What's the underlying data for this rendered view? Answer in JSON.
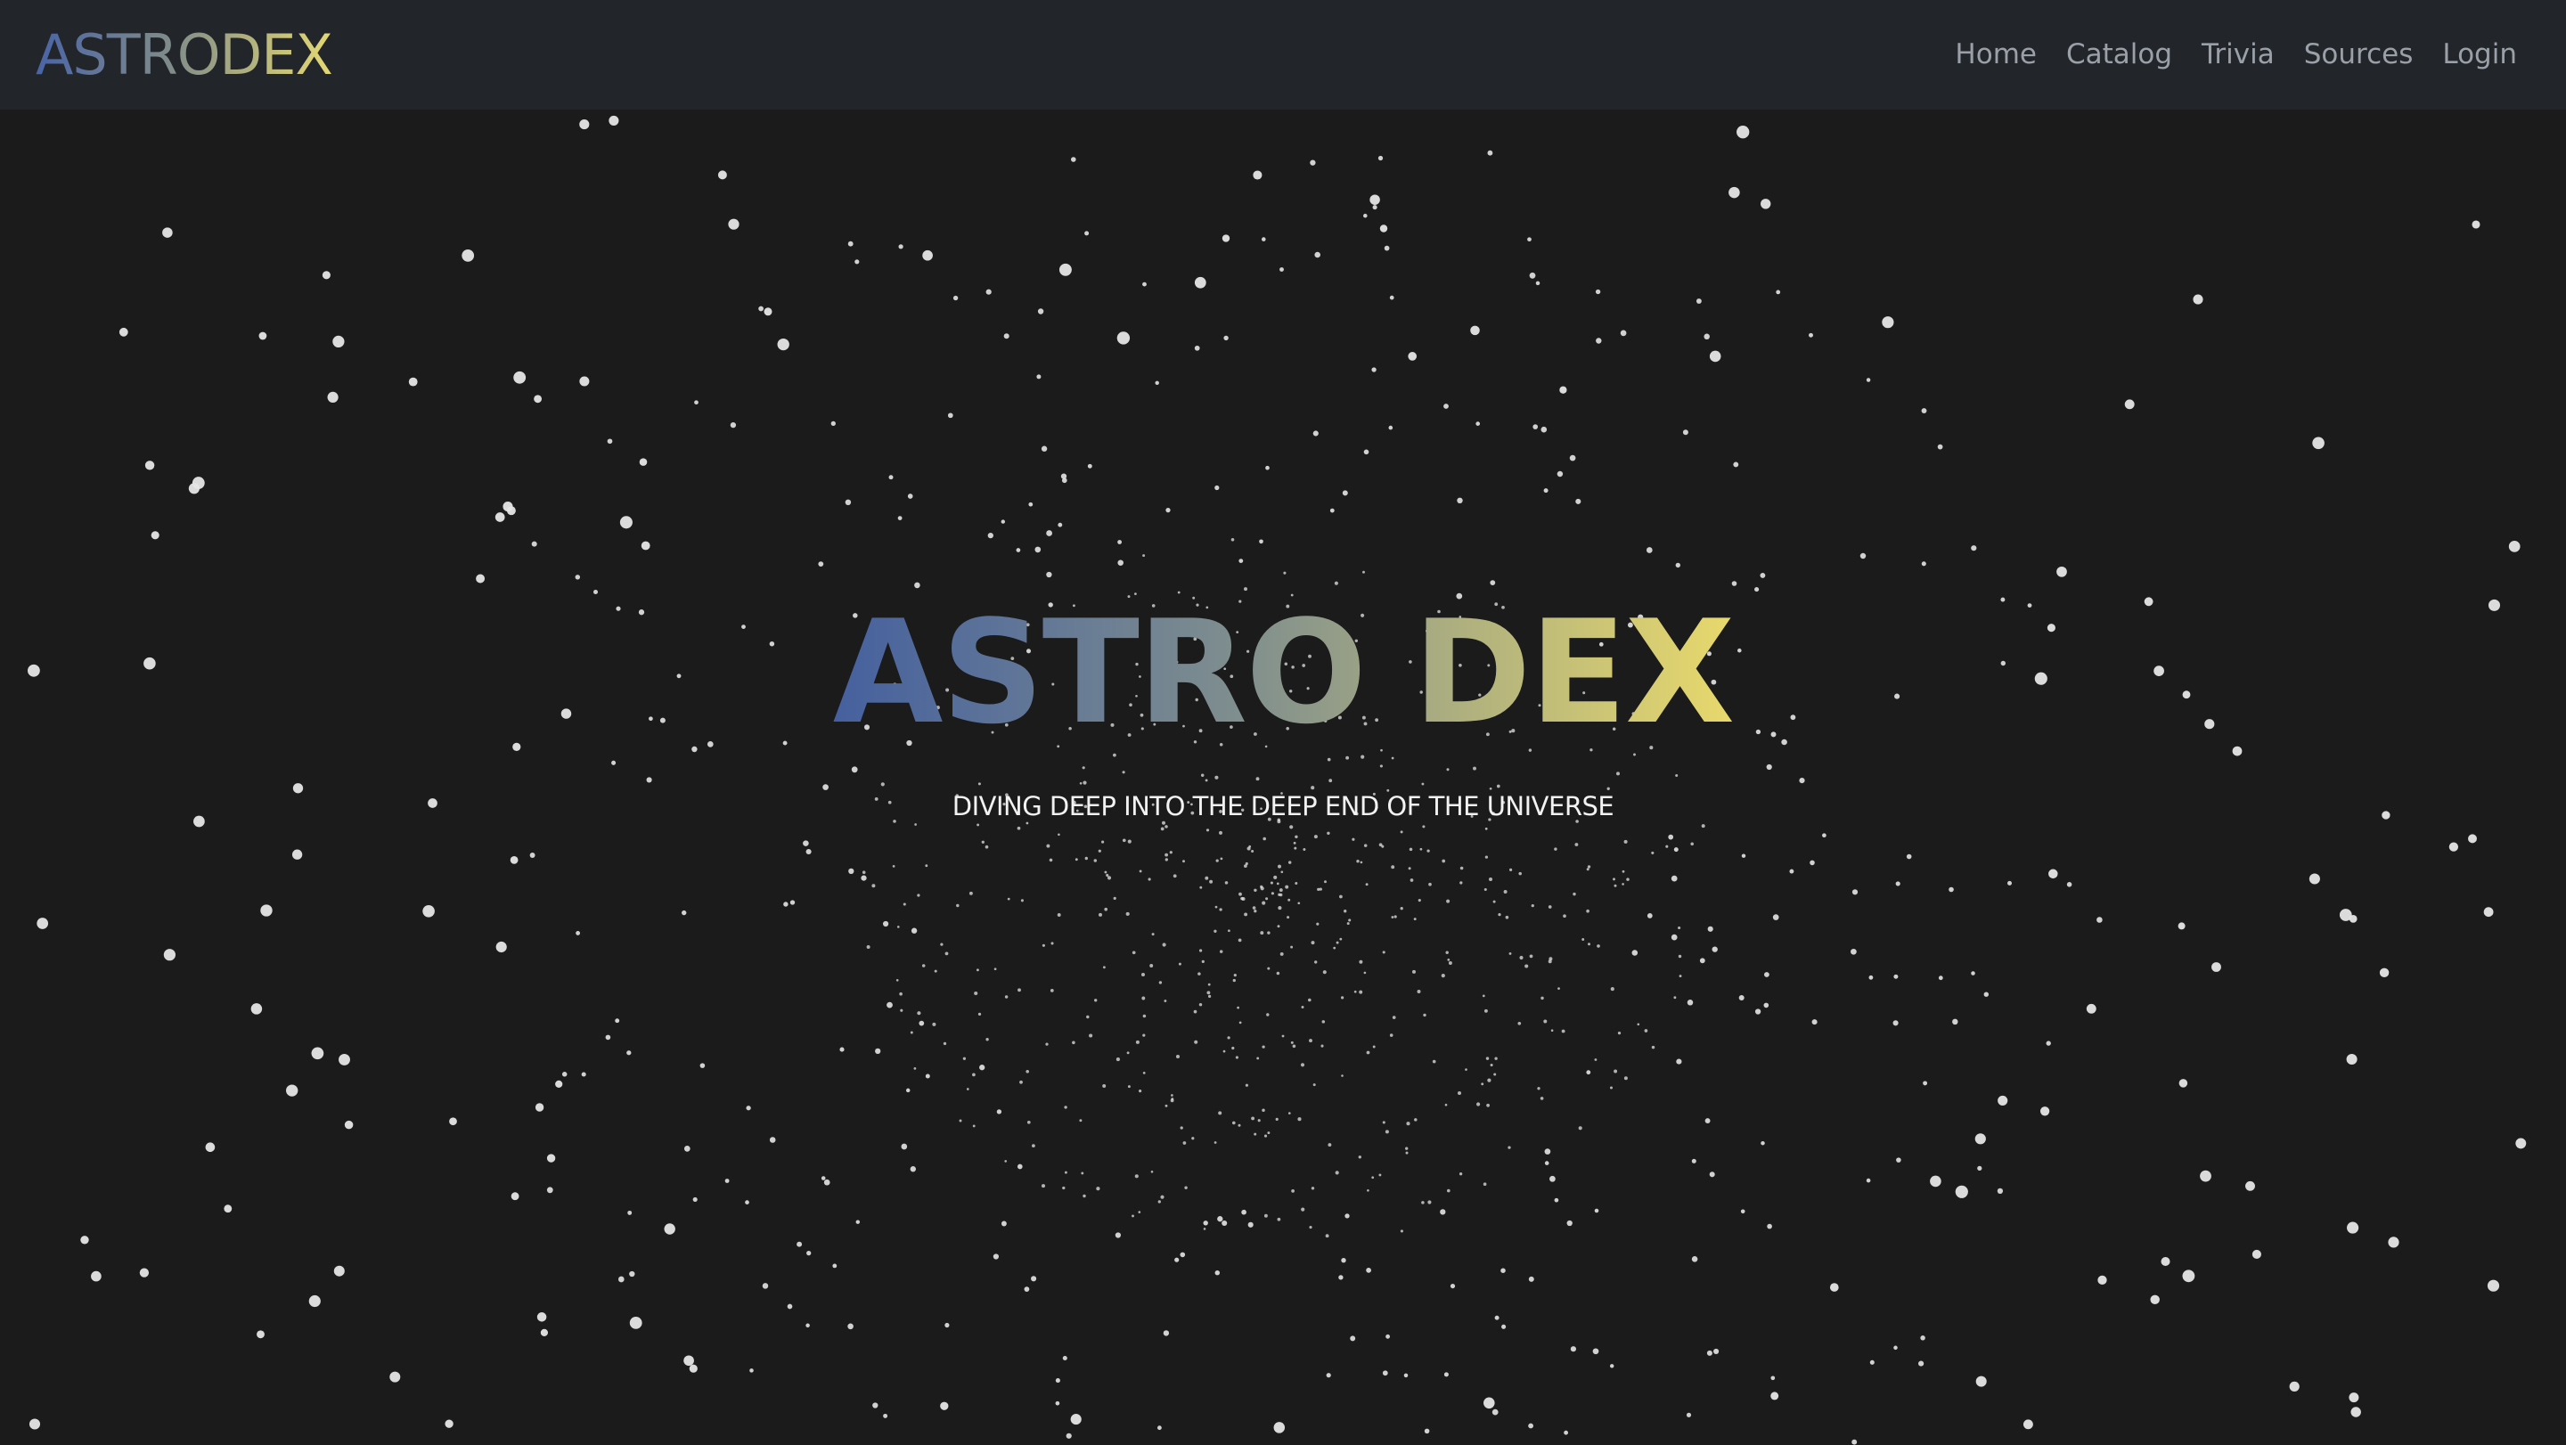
{
  "navbar": {
    "brand": "ASTRODEX",
    "links": [
      {
        "label": "Home"
      },
      {
        "label": "Catalog"
      },
      {
        "label": "Trivia"
      },
      {
        "label": "Sources"
      },
      {
        "label": "Login"
      }
    ]
  },
  "hero": {
    "title": "ASTRO DEX",
    "subtitle": "DIVING DEEP INTO THE DEEP END OF THE UNIVERSE"
  },
  "colors": {
    "background": "#1b1b1c",
    "navbar": "#22252a",
    "gradient_start": "#45609f",
    "gradient_end": "#e8d96c",
    "star": "#e6e6e6"
  }
}
